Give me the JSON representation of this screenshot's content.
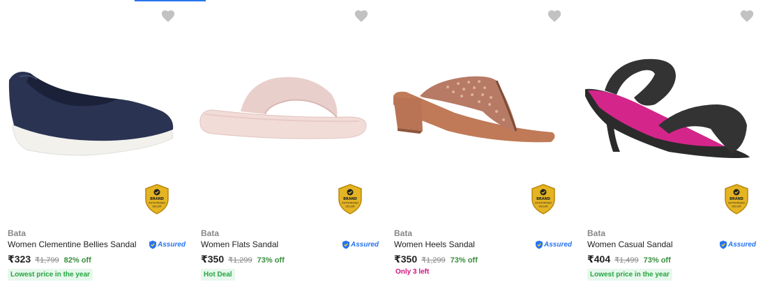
{
  "colors": {
    "accent": "#2874f0",
    "discount": "#388e3c",
    "tag_green_bg": "#e7f8ec",
    "tag_green_text": "#26a541",
    "stock_warning": "#d1117d",
    "wishlist_icon": "#c2c2c2"
  },
  "products": [
    {
      "brand": "Bata",
      "title": "Women Clementine Bellies Sandal",
      "assured_label": "Assured",
      "price": "₹323",
      "mrp": "₹1,799",
      "discount": "82% off",
      "tag": "Lowest price in the year",
      "tag_style": "green",
      "badge": [
        "BRAND",
        "AUTHORISED",
        "SELLER"
      ],
      "image_icon": "navy-bellies-shoe"
    },
    {
      "brand": "Bata",
      "title": "Women Flats Sandal",
      "assured_label": "Assured",
      "price": "₹350",
      "mrp": "₹1,299",
      "discount": "73% off",
      "tag": "Hot Deal",
      "tag_style": "green",
      "badge": [
        "BRAND",
        "AUTHORISED",
        "SELLER"
      ],
      "image_icon": "pink-flat-slide"
    },
    {
      "brand": "Bata",
      "title": "Women Heels Sandal",
      "assured_label": "Assured",
      "price": "₹350",
      "mrp": "₹1,299",
      "discount": "73% off",
      "tag": "Only 3 left",
      "tag_style": "plain",
      "badge": [
        "BRAND",
        "AUTHORISED",
        "SELLER"
      ],
      "image_icon": "brown-heel-thong"
    },
    {
      "brand": "Bata",
      "title": "Women Casual Sandal",
      "assured_label": "Assured",
      "price": "₹404",
      "mrp": "₹1,499",
      "discount": "73% off",
      "tag": "Lowest price in the year",
      "tag_style": "green",
      "badge": [
        "BRAND",
        "AUTHORISED",
        "SELLER"
      ],
      "image_icon": "black-kitten-heel"
    }
  ]
}
